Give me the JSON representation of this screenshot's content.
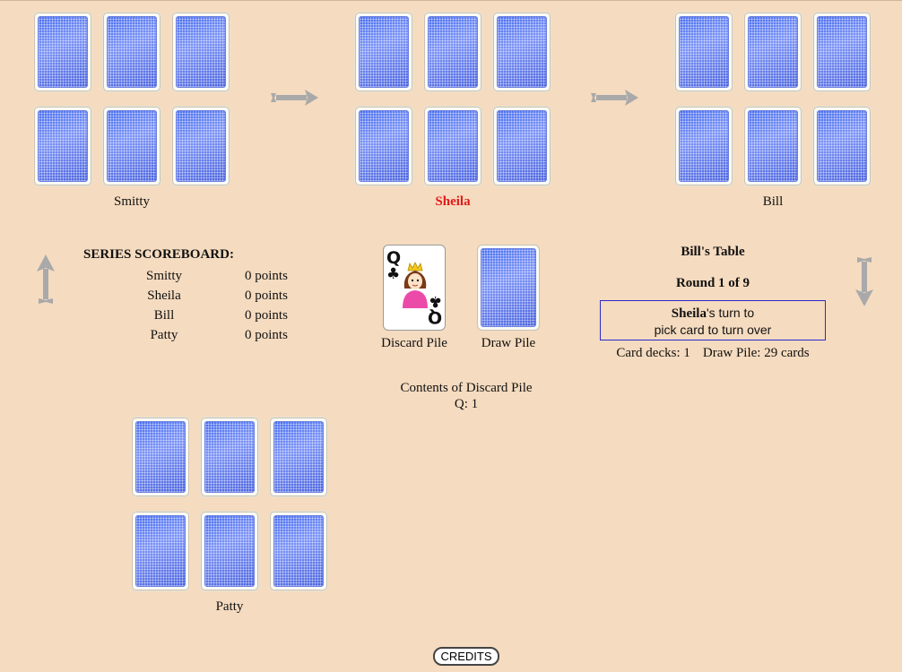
{
  "players": {
    "smitty": {
      "name": "Smitty"
    },
    "sheila": {
      "name": "Sheila"
    },
    "bill": {
      "name": "Bill"
    },
    "patty": {
      "name": "Patty"
    }
  },
  "scoreboard": {
    "title": "SERIES SCOREBOARD:",
    "rows": [
      {
        "name": "Smitty",
        "points": "0 points"
      },
      {
        "name": "Sheila",
        "points": "0 points"
      },
      {
        "name": "Bill",
        "points": "0 points"
      },
      {
        "name": "Patty",
        "points": "0 points"
      }
    ]
  },
  "discard_pile": {
    "label": "Discard Pile",
    "top_card": {
      "rank": "Q",
      "suit": "♣",
      "suit_name": "clubs"
    }
  },
  "draw_pile": {
    "label": "Draw Pile"
  },
  "table_info": {
    "table_name": "Bill's Table",
    "round": "Round 1 of 9",
    "turn_player": "Sheila",
    "turn_suffix": "'s turn to",
    "turn_action": "pick card to turn over",
    "card_decks": "Card decks: 1",
    "draw_pile_count": "Draw Pile: 29 cards"
  },
  "discard_contents": {
    "title": "Contents of Discard Pile",
    "value": "Q: 1"
  },
  "credits_button": "CREDITS",
  "colors": {
    "background": "#f5dbbf",
    "active_player": "#e21a1a",
    "turn_box_border": "#2b2bd0",
    "card_back": "#5b78ee",
    "arrow": "#a9a9a9"
  }
}
